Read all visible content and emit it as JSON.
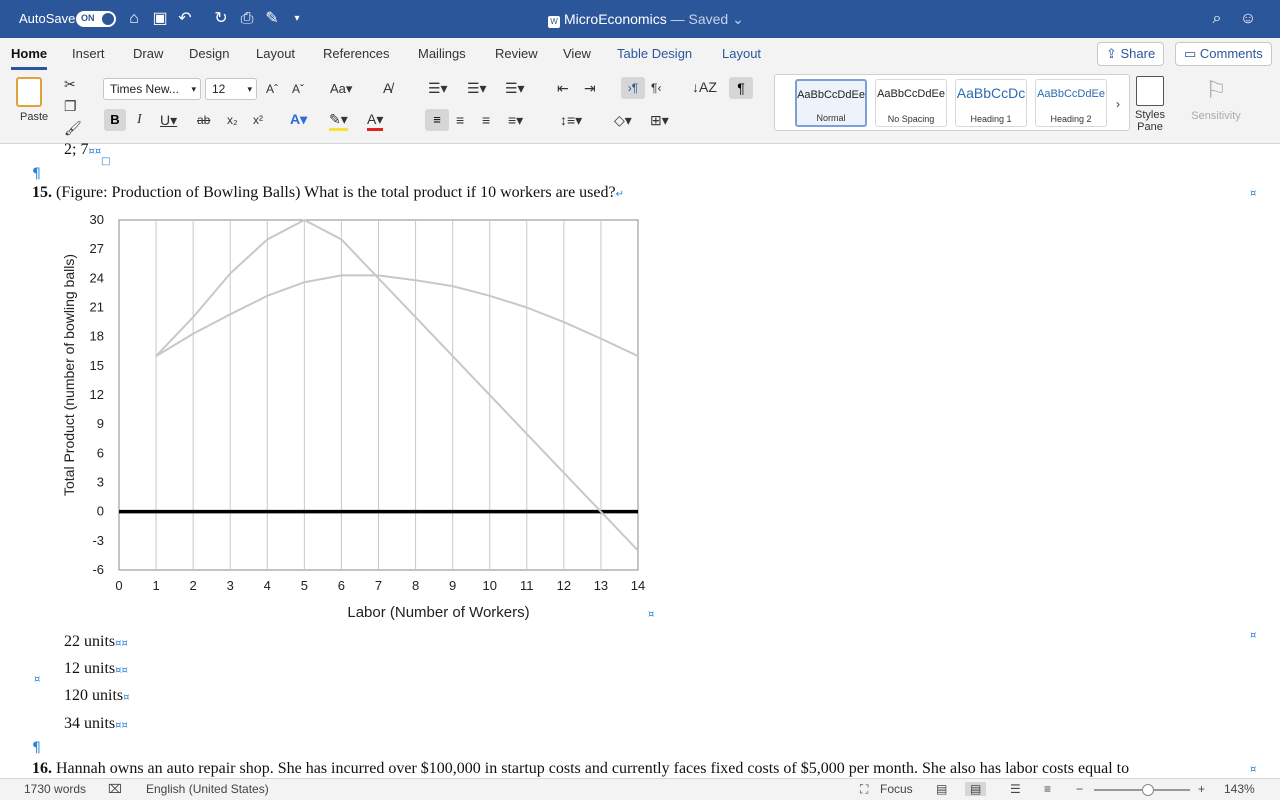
{
  "titlebar": {
    "autosave_label": "AutoSave",
    "toggle_label": "ON",
    "doc_name": "MicroEconomics",
    "doc_status": " — Saved"
  },
  "ribbon": {
    "tabs": [
      "Home",
      "Insert",
      "Draw",
      "Design",
      "Layout",
      "References",
      "Mailings",
      "Review",
      "View",
      "Table Design",
      "Layout"
    ],
    "share_label": "Share",
    "comments_label": "Comments"
  },
  "toolbar": {
    "paste_label": "Paste",
    "font_name": "Times New...",
    "font_size": "12",
    "styles": [
      {
        "sample": "AaBbCcDdEe",
        "name": "Normal"
      },
      {
        "sample": "AaBbCcDdEe",
        "name": "No Spacing"
      },
      {
        "sample": "AaBbCcDc",
        "name": "Heading 1"
      },
      {
        "sample": "AaBbCcDdEe",
        "name": "Heading 2"
      }
    ],
    "styles_pane_label1": "Styles",
    "styles_pane_label2": "Pane",
    "sensitivity_label": "Sensitivity"
  },
  "document": {
    "prev_line": "2; 7",
    "q15_number": "15.",
    "q15_text": "(Figure: Production of Bowling Balls) What is the total product if 10 workers are used?",
    "answers": [
      "22 units",
      "12 units",
      "120 units",
      "34 units"
    ],
    "q16_number": "16.",
    "q16_text": "Hannah owns an auto repair shop. She has incurred over $100,000 in startup costs and currently faces fixed costs of $5,000 per month. She also has labor costs equal to"
  },
  "statusbar": {
    "words": "1730 words",
    "language": "English (United States)",
    "focus": "Focus",
    "zoom": "143%"
  },
  "chart_data": {
    "type": "line",
    "xlabel": "Labor (Number of Workers)",
    "ylabel": "Total Product (number of bowling balls)",
    "xlim": [
      0,
      14
    ],
    "ylim": [
      -6,
      30
    ],
    "xticks": [
      "0",
      "1",
      "2",
      "3",
      "4",
      "5",
      "6",
      "7",
      "8",
      "9",
      "10",
      "11",
      "12",
      "13",
      "14"
    ],
    "yticks": [
      "30",
      "27",
      "24",
      "21",
      "18",
      "15",
      "12",
      "9",
      "6",
      "3",
      "0",
      "-3",
      "-6"
    ],
    "grid": "vertical",
    "series": [
      {
        "x": [
          1,
          2,
          3,
          4,
          5,
          6,
          7,
          8,
          9,
          10,
          11,
          12,
          13,
          14
        ],
        "values": [
          16,
          20,
          24.5,
          28,
          30,
          28,
          24,
          20,
          16,
          12,
          8,
          4,
          0,
          -4
        ],
        "color": "#c8c8c8"
      },
      {
        "x": [
          1,
          2,
          3,
          4,
          5,
          6,
          7,
          8,
          9,
          10,
          11,
          12,
          13,
          14
        ],
        "values": [
          16,
          18.3,
          20.3,
          22.2,
          23.6,
          24.3,
          24.3,
          23.8,
          23.2,
          22.2,
          21,
          19.5,
          17.8,
          16
        ],
        "color": "#c8c8c8"
      }
    ],
    "zero_line_color": "#000000"
  }
}
